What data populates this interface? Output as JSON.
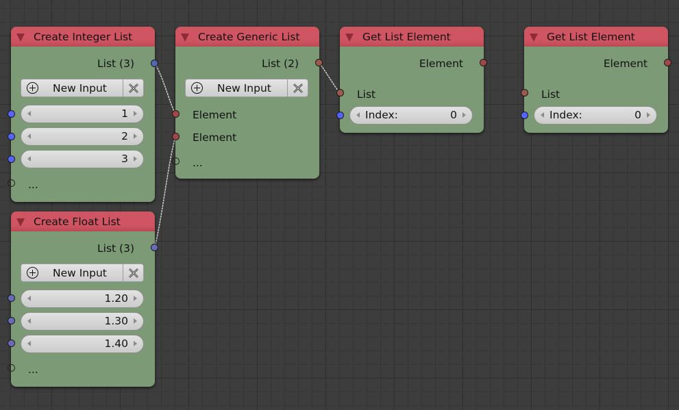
{
  "nodes": {
    "int_list": {
      "title": "Create Integer List",
      "output": "List (3)",
      "new_input": "New Input",
      "values": [
        "1",
        "2",
        "3"
      ],
      "more": "..."
    },
    "float_list": {
      "title": "Create Float List",
      "output": "List (3)",
      "new_input": "New Input",
      "values": [
        "1.20",
        "1.30",
        "1.40"
      ],
      "more": "..."
    },
    "generic_list": {
      "title": "Create Generic List",
      "output": "List (2)",
      "new_input": "New Input",
      "inputs": [
        "Element",
        "Element"
      ],
      "more": "..."
    },
    "get_elem_1": {
      "title": "Get List Element",
      "output": "Element",
      "input_list": "List",
      "index_label": "Index:",
      "index_value": "0"
    },
    "get_elem_2": {
      "title": "Get List Element",
      "output": "Element",
      "input_list": "List",
      "index_label": "Index:",
      "index_value": "0"
    }
  },
  "colors": {
    "node_body": "#7c9a76",
    "node_header": "#d05563",
    "socket_int": "#5864ff",
    "socket_list": "#a04848",
    "link": "#d8d8d8",
    "background": "#3d3d3d"
  }
}
